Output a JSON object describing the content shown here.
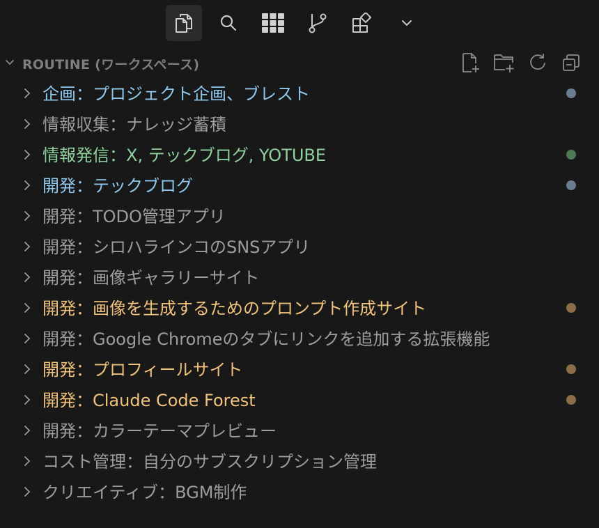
{
  "toolbar": {
    "tabs": [
      {
        "icon": "explorer-files-icon",
        "active": true
      },
      {
        "icon": "search-icon",
        "active": false
      },
      {
        "icon": "grid-apps-icon",
        "active": false
      },
      {
        "icon": "source-control-icon",
        "active": false
      },
      {
        "icon": "extensions-icon",
        "active": false
      },
      {
        "icon": "chevron-down-icon",
        "active": false
      }
    ]
  },
  "section": {
    "title": "ROUTINE (ワークスペース)",
    "actions": [
      "new-file-icon",
      "new-folder-icon",
      "refresh-icon",
      "collapse-all-icon"
    ]
  },
  "colors": {
    "blue": "#8ec8ee",
    "green": "#8fd19e",
    "orange": "#f0c27c",
    "gray": "#9d9d9d",
    "dot_blue": "#6b7c90",
    "dot_green": "#4d7a55",
    "dot_orange": "#8a6d44"
  },
  "tree": {
    "items": [
      {
        "label": "企画：プロジェクト企画、ブレスト",
        "color": "#8ec8ee",
        "dot": "#6b7c90"
      },
      {
        "label": "情報収集：ナレッジ蓄積",
        "color": "#9d9d9d",
        "dot": null
      },
      {
        "label": "情報発信：X, テックブログ, YOTUBE",
        "color": "#8fd19e",
        "dot": "#4d7a55"
      },
      {
        "label": "開発：テックブログ",
        "color": "#8ec8ee",
        "dot": "#6b7c90"
      },
      {
        "label": "開発：TODO管理アプリ",
        "color": "#9d9d9d",
        "dot": null
      },
      {
        "label": "開発：シロハラインコのSNSアプリ",
        "color": "#9d9d9d",
        "dot": null
      },
      {
        "label": "開発：画像ギャラリーサイト",
        "color": "#9d9d9d",
        "dot": null
      },
      {
        "label": "開発：画像を生成するためのプロンプト作成サイト",
        "color": "#f0c27c",
        "dot": "#8a6d44"
      },
      {
        "label": "開発：Google Chromeのタブにリンクを追加する拡張機能",
        "color": "#9d9d9d",
        "dot": null
      },
      {
        "label": "開発：プロフィールサイト",
        "color": "#f0c27c",
        "dot": "#8a6d44"
      },
      {
        "label": "開発：Claude Code Forest",
        "color": "#f0c27c",
        "dot": "#8a6d44"
      },
      {
        "label": "開発：カラーテーマプレビュー",
        "color": "#9d9d9d",
        "dot": null
      },
      {
        "label": "コスト管理：自分のサブスクリプション管理",
        "color": "#9d9d9d",
        "dot": null
      },
      {
        "label": "クリエイティブ：BGM制作",
        "color": "#9d9d9d",
        "dot": null
      }
    ]
  }
}
